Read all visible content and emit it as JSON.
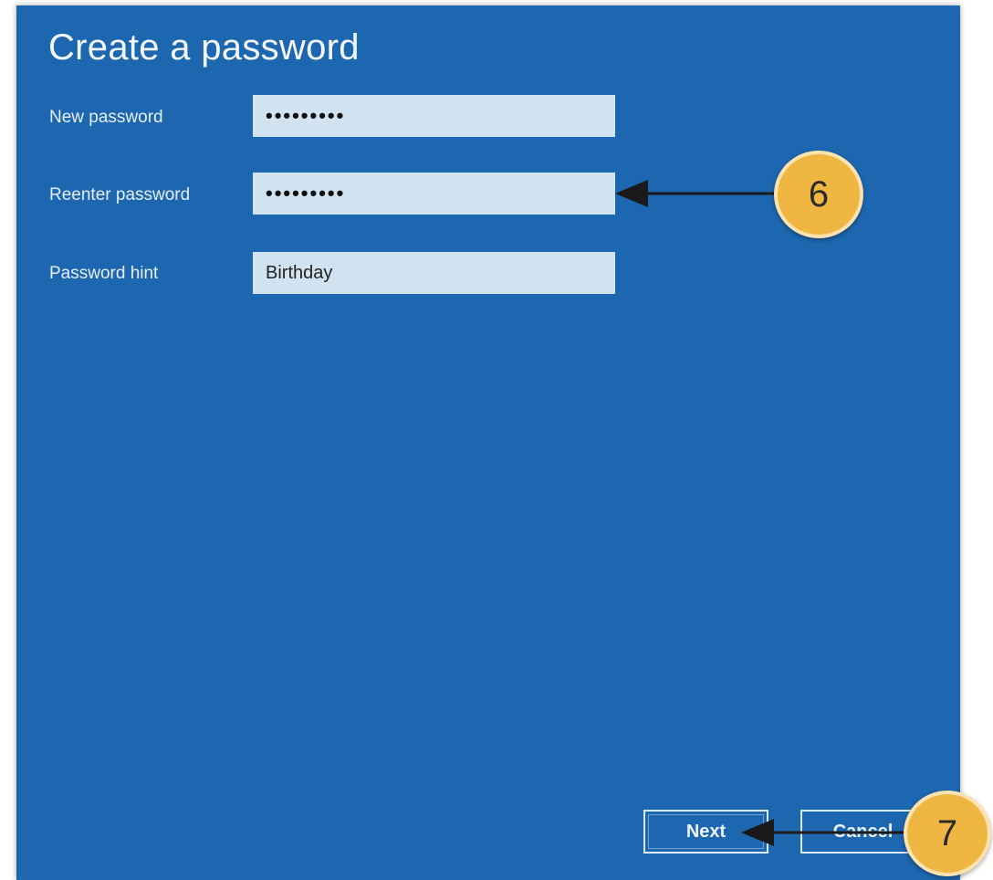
{
  "dialog": {
    "title": "Create a password",
    "fields": [
      {
        "label": "New password",
        "value": "•••••••••",
        "masked": true
      },
      {
        "label": "Reenter password",
        "value": "•••••••••",
        "masked": true
      },
      {
        "label": "Password hint",
        "value": "Birthday",
        "masked": false
      }
    ],
    "buttons": {
      "next": "Next",
      "cancel": "Cancel"
    }
  },
  "callouts": [
    {
      "number": "6",
      "target": "reenter-password-field"
    },
    {
      "number": "7",
      "target": "next-button"
    }
  ],
  "colors": {
    "panel_bg": "#1d67b0",
    "field_bg": "#d1e2f1",
    "callout_fill": "#f0b642"
  }
}
